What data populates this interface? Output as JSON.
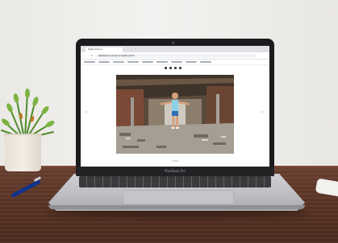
{
  "browser": {
    "tab_title": "Digital photo by ...",
    "url": "digitalphoto.example.com/gallery/photo",
    "nav_back": "←",
    "nav_forward": "→",
    "nav_reload": "↻",
    "prev_arrow": "‹",
    "next_arrow": "›",
    "footer": "© photo"
  },
  "laptop": {
    "model_label": "MacBook Pro"
  },
  "colors": {
    "wall": "#efedea",
    "desk": "#5b3526",
    "laptop_body": "#bdbec2",
    "pen": "#12328a"
  }
}
